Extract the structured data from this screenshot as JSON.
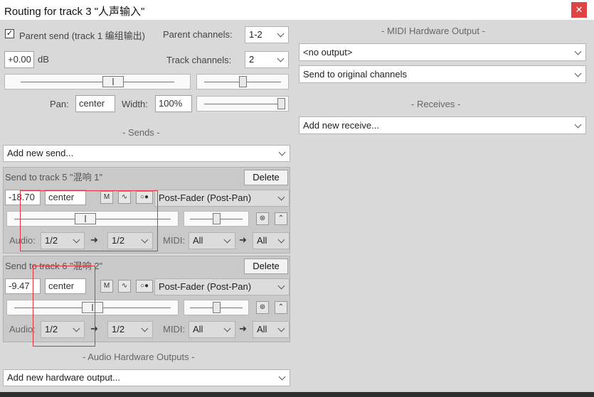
{
  "window": {
    "title": "Routing for track 3 \"人声输入\"",
    "close_glyph": "✕"
  },
  "parent": {
    "checked": true,
    "checkbox_glyph": "✓",
    "send_label": "Parent send (track 1 编组输出)",
    "channels_label": "Parent channels:",
    "channels_value": "1-2",
    "volume": "+0.00",
    "db_label": "dB",
    "track_channels_label": "Track channels:",
    "track_channels_value": "2",
    "pan_label": "Pan:",
    "pan_value": "center",
    "width_label": "Width:",
    "width_value": "100%"
  },
  "sends": {
    "section_label": "- Sends -",
    "add_placeholder": "Add new send...",
    "items": [
      {
        "title": "Send to track 5 \"混响 1\"",
        "delete_label": "Delete",
        "volume": "-18.70",
        "pan": "center",
        "mute_label": "M",
        "phase_glyph": "∿",
        "mono_glyph": "○●",
        "mode": "Post-Fader (Post-Pan)",
        "audio_label": "Audio:",
        "audio_src": "1/2",
        "audio_dst": "1/2",
        "midi_label": "MIDI:",
        "midi_src": "All",
        "midi_dst": "All",
        "arrow_glyph": "➜",
        "env_glyph": "⊛",
        "env2_glyph": "⌃"
      },
      {
        "title": "Send to track 6 \"混响 2\"",
        "delete_label": "Delete",
        "volume": "-9.47",
        "pan": "center",
        "mute_label": "M",
        "phase_glyph": "∿",
        "mono_glyph": "○●",
        "mode": "Post-Fader (Post-Pan)",
        "audio_label": "Audio:",
        "audio_src": "1/2",
        "audio_dst": "1/2",
        "midi_label": "MIDI:",
        "midi_src": "All",
        "midi_dst": "All",
        "arrow_glyph": "➜",
        "env_glyph": "⊛",
        "env2_glyph": "⌃"
      }
    ]
  },
  "hw_outputs": {
    "section_label": "- Audio Hardware Outputs -",
    "add_placeholder": "Add new hardware output..."
  },
  "midi_hw": {
    "section_label": "- MIDI Hardware Output -",
    "output_value": "<no output>",
    "channels_value": "Send to original channels"
  },
  "receives": {
    "section_label": "- Receives -",
    "add_placeholder": "Add new receive..."
  },
  "sliders": {
    "volume_level": 0.6,
    "pan_level": 0.5,
    "width_level": 1.0,
    "send1_volume_level": 0.45,
    "send1_pan_level": 0.5,
    "send2_volume_level": 0.5,
    "send2_pan_level": 0.5
  },
  "colors": {
    "highlight": "#e0343a",
    "close": "#e04343"
  }
}
